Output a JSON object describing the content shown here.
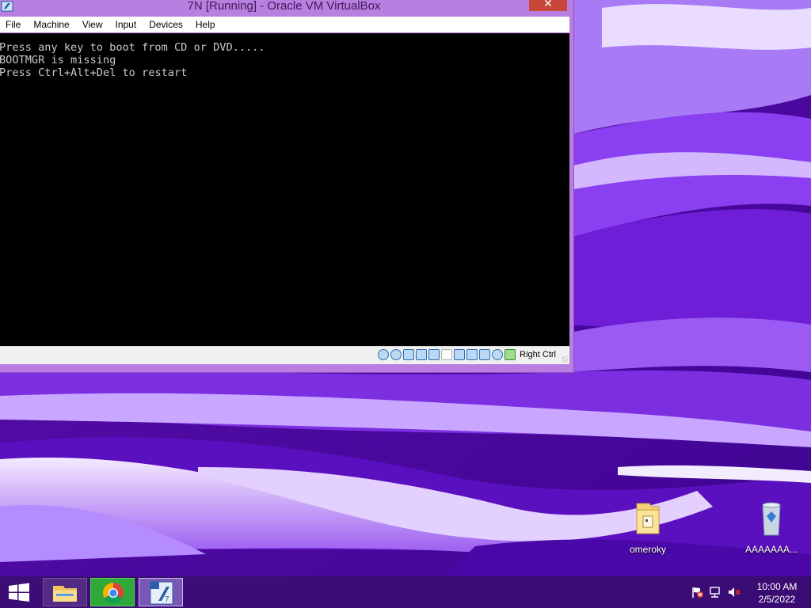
{
  "window": {
    "title": "7N [Running] - Oracle VM VirtualBox",
    "close_label": "✕",
    "menu": [
      "File",
      "Machine",
      "View",
      "Input",
      "Devices",
      "Help"
    ]
  },
  "vm_screen": {
    "lines": [
      "Press any key to boot from CD or DVD.....",
      "BOOTMGR is missing",
      "Press Ctrl+Alt+Del to restart"
    ]
  },
  "status_bar": {
    "icons": [
      "hard-disk-icon",
      "optical-drive-icon",
      "audio-icon",
      "network-icon",
      "usb-icon",
      "shared-folder-icon",
      "display-icon",
      "video-capture-icon",
      "mouse-integration-icon",
      "cpu-icon",
      "host-key-icon"
    ],
    "host_key": "Right Ctrl"
  },
  "desktop_icons": [
    {
      "label": "omeroky",
      "icon": "folder-icon"
    },
    {
      "label": "AAAAAAA...",
      "icon": "recycle-bin-icon"
    }
  ],
  "taskbar": {
    "apps": [
      "file-explorer-icon",
      "chrome-icon",
      "virtualbox-icon"
    ],
    "tray_icons": [
      "action-center-flag-icon",
      "network-icon",
      "speaker-muted-icon"
    ],
    "time": "10:00 AM",
    "date": "2/5/2022"
  },
  "colors": {
    "title_bar": "#b87fe0",
    "close_button": "#c7463a",
    "taskbar": "#3a0e6e",
    "vm_text": "#c8c8c8"
  }
}
